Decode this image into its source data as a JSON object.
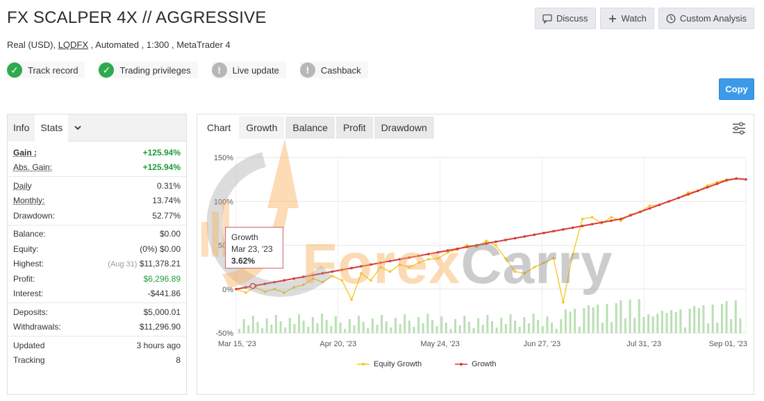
{
  "header": {
    "title": "FX SCALPER 4X // AGGRESSIVE",
    "subtitle_pre": "Real (USD), ",
    "subtitle_link": "LQDFX",
    "subtitle_post": " , Automated , 1:300 , MetaTrader 4"
  },
  "top_buttons": {
    "discuss": "Discuss",
    "watch": "Watch",
    "custom_analysis": "Custom Analysis"
  },
  "badges": [
    {
      "label": "Track record",
      "status": "ok"
    },
    {
      "label": "Trading privileges",
      "status": "ok"
    },
    {
      "label": "Live update",
      "status": "warn"
    },
    {
      "label": "Cashback",
      "status": "warn"
    }
  ],
  "copy_label": "Copy",
  "left_tabs": {
    "info": "Info",
    "stats": "Stats"
  },
  "stats": {
    "gain_label": "Gain :",
    "gain": "+125.94%",
    "abs_gain_label": "Abs. Gain:",
    "abs_gain": "+125.94%",
    "daily_label": "Daily",
    "daily": "0.31%",
    "monthly_label": "Monthly:",
    "monthly": "13.74%",
    "drawdown_label": "Drawdown:",
    "drawdown": "52.77%",
    "balance_label": "Balance:",
    "balance": "$0.00",
    "equity_label": "Equity:",
    "equity_pct": "(0%)",
    "equity": "$0.00",
    "highest_label": "Highest:",
    "highest_date": "(Aug 31)",
    "highest": "$11,378.21",
    "profit_label": "Profit:",
    "profit": "$6,296.89",
    "interest_label": "Interest:",
    "interest": "-$441.86",
    "deposits_label": "Deposits:",
    "deposits": "$5,000.01",
    "withdrawals_label": "Withdrawals:",
    "withdrawals": "$11,296.90",
    "updated_label": "Updated",
    "updated": "3 hours ago",
    "tracking_label": "Tracking",
    "tracking": "8"
  },
  "chart_tabs": {
    "chart": "Chart",
    "growth": "Growth",
    "balance": "Balance",
    "profit": "Profit",
    "drawdown": "Drawdown"
  },
  "tooltip": {
    "series": "Growth",
    "date": "Mar 23, '23",
    "value": "3.62%"
  },
  "watermark": {
    "brand_a": "Forex",
    "brand_b": "Carry"
  },
  "colors": {
    "equity": "#f5c518",
    "growth": "#d63a3a",
    "bars": "#a8d8a0",
    "accent": "#3c9ae8",
    "green": "#1e9b39"
  },
  "chart_data": {
    "type": "line",
    "y_ticks": [
      "150%",
      "100%",
      "50%",
      "0%",
      "-50%"
    ],
    "x_ticks": [
      "Mar 15, '23",
      "Apr 20, '23",
      "May 24, '23",
      "Jun 27, '23",
      "Jul 31, '23",
      "Sep 01, '23"
    ],
    "ylim": [
      -50,
      150
    ],
    "series": [
      {
        "name": "Growth",
        "color": "#d63a3a",
        "values": [
          0,
          2,
          4,
          6,
          8,
          10,
          12,
          14,
          16,
          18,
          20,
          22,
          24,
          26,
          28,
          30,
          32,
          34,
          36,
          38,
          40,
          42,
          44,
          46,
          48,
          50,
          52,
          54,
          56,
          58,
          60,
          62,
          64,
          66,
          68,
          70,
          72,
          74,
          76,
          78,
          80,
          84,
          88,
          92,
          96,
          100,
          104,
          108,
          112,
          116,
          120,
          124,
          126,
          125
        ]
      },
      {
        "name": "Equity Growth",
        "color": "#f5c518",
        "values": [
          0,
          -4,
          2,
          -3,
          0,
          -4,
          2,
          5,
          12,
          8,
          15,
          10,
          -12,
          18,
          10,
          25,
          20,
          28,
          25,
          30,
          34,
          35,
          42,
          45,
          50,
          48,
          55,
          50,
          35,
          20,
          18,
          25,
          30,
          35,
          -15,
          40,
          80,
          82,
          75,
          82,
          78,
          85,
          88,
          95,
          96,
          100,
          104,
          110,
          112,
          118,
          122,
          125,
          126,
          125
        ]
      }
    ],
    "legend": [
      "Equity Growth",
      "Growth"
    ]
  }
}
